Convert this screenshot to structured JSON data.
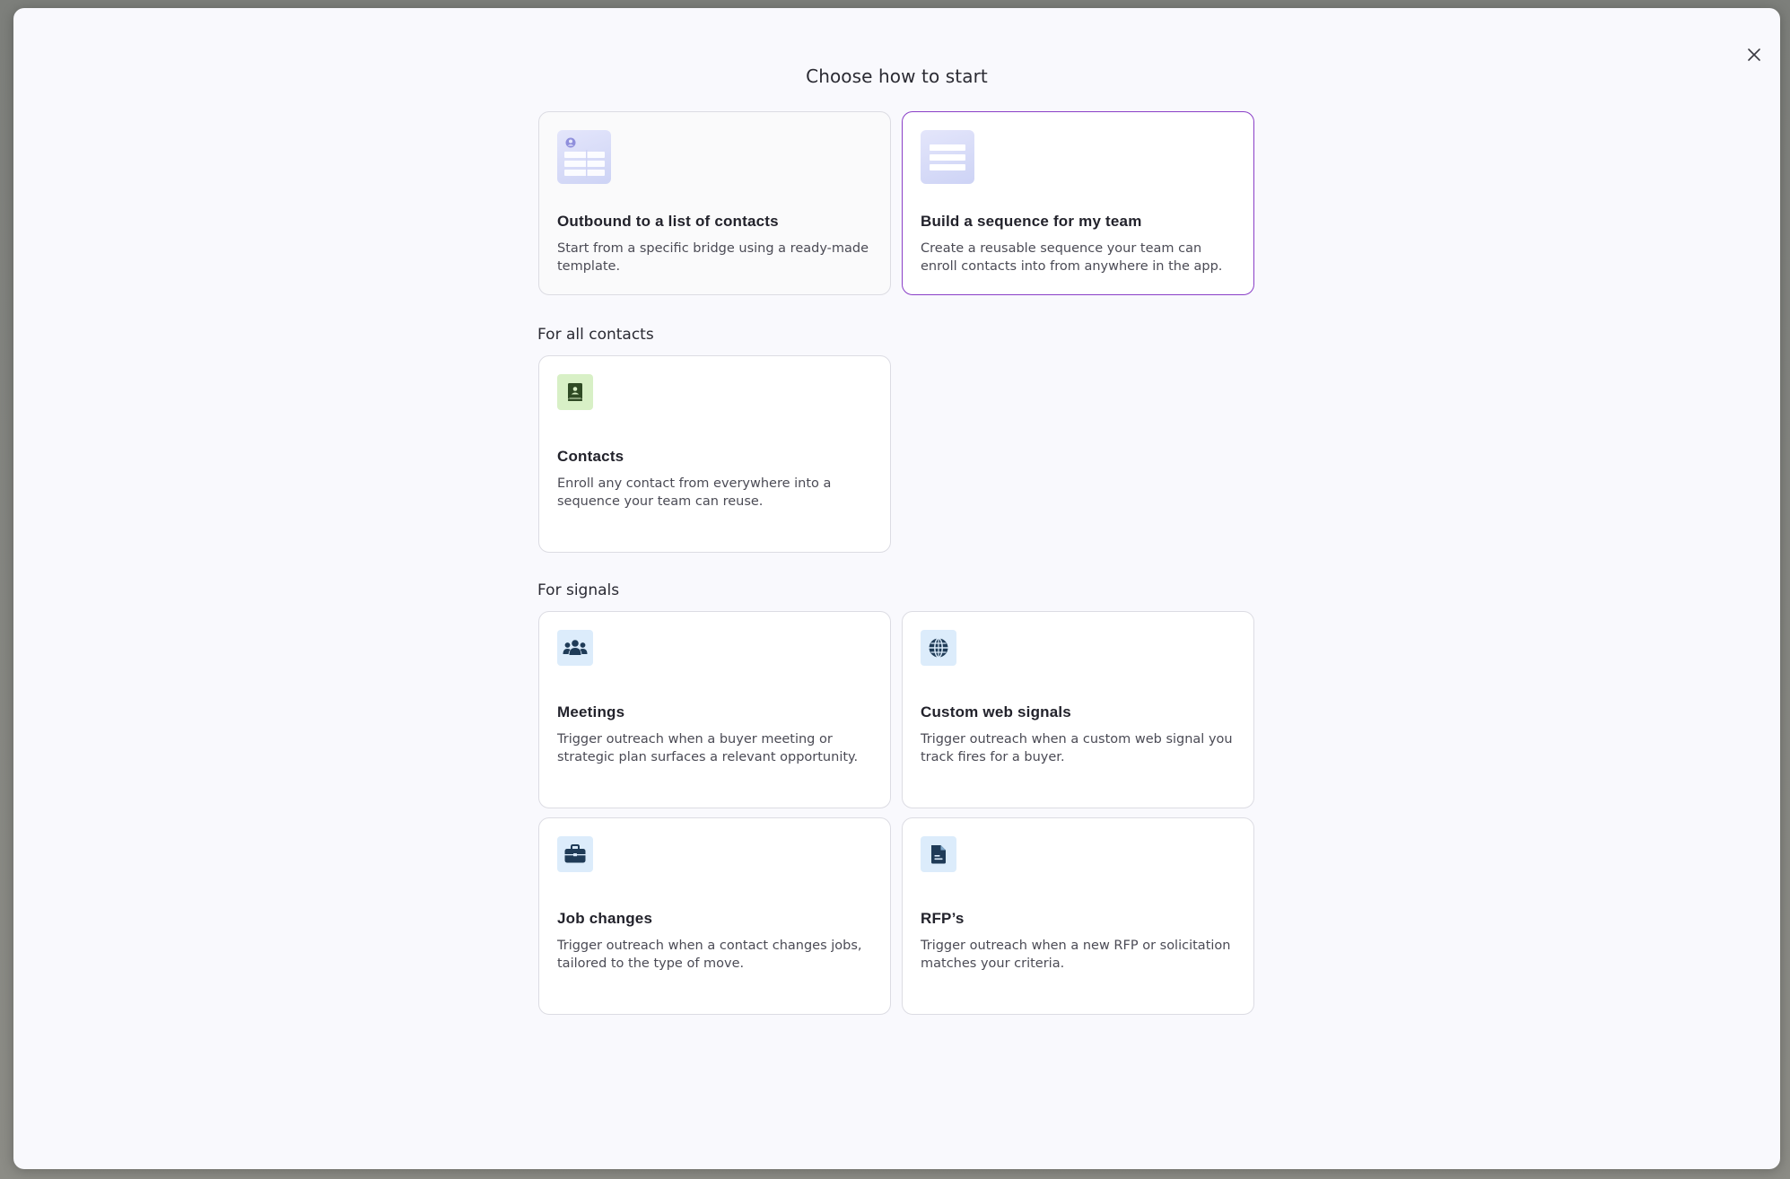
{
  "dialog": {
    "title": "Choose how to start",
    "close_icon": "close-icon"
  },
  "top_options": [
    {
      "title": "Outbound to a list of contacts",
      "description": "Start from a specific bridge using a ready-made template.",
      "icon": "contact-list-illustration",
      "state": "default"
    },
    {
      "title": "Build a sequence for my team",
      "description": "Create a reusable sequence your team can enroll contacts into from anywhere in the app.",
      "icon": "sequence-list-illustration",
      "state": "selected"
    }
  ],
  "sections": {
    "all_contacts": {
      "label": "For all contacts",
      "cards": [
        {
          "title": "Contacts",
          "description": "Enroll any contact from everywhere into a sequence your team can reuse.",
          "icon": "contact-book-icon"
        }
      ]
    },
    "signals": {
      "label": "For signals",
      "cards": [
        {
          "title": "Meetings",
          "description": "Trigger outreach when a buyer meeting or strategic plan surfaces a relevant opportunity.",
          "icon": "people-group-icon"
        },
        {
          "title": "Custom web signals",
          "description": "Trigger outreach when a custom web signal you track fires for a buyer.",
          "icon": "globe-icon"
        },
        {
          "title": "Job changes",
          "description": "Trigger outreach when a contact changes jobs, tailored to the type of move.",
          "icon": "briefcase-icon"
        },
        {
          "title": "RFP’s",
          "description": "Trigger outreach when a new RFP or solicitation matches your criteria.",
          "icon": "document-icon"
        }
      ]
    }
  },
  "colors": {
    "accent_selected_border": "#8a3fc7",
    "icon_dark": "#1f3b57",
    "icon_blue_bg": "#dcecfb",
    "icon_green_bg": "#d8f0c6",
    "icon_green_fg": "#2f4a24"
  }
}
